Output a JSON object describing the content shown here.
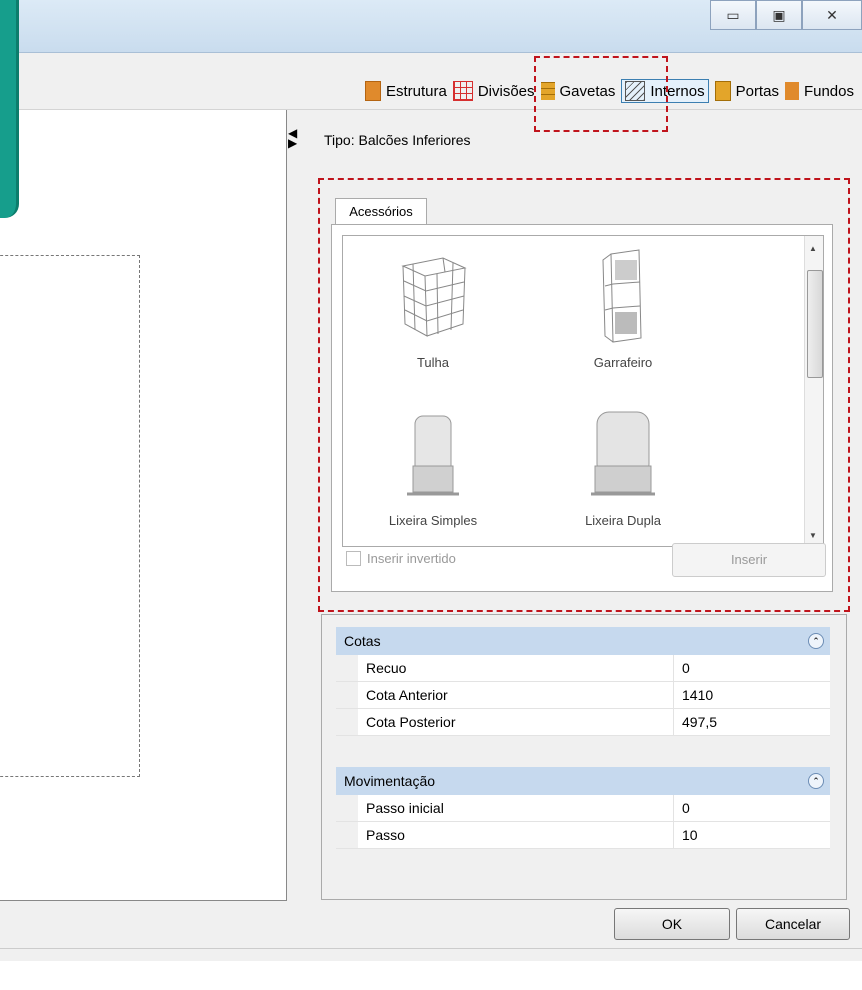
{
  "toolbar": {
    "items": [
      {
        "label": "Estrutura",
        "color": "#e08a2c"
      },
      {
        "label": "Divisões",
        "color": "#d62f2f"
      },
      {
        "label": "Gavetas",
        "color": "#e3a52a"
      },
      {
        "label": "Internos",
        "color": "#555555"
      },
      {
        "label": "Portas",
        "color": "#e3a52a"
      },
      {
        "label": "Fundos",
        "color": "#e08a2c"
      }
    ]
  },
  "tipo": "Tipo: Balcões Inferiores",
  "tabs": {
    "accessories": "Acessórios"
  },
  "gallery": {
    "items": [
      "Tulha",
      "Garrafeiro",
      "Lixeira Simples",
      "Lixeira Dupla"
    ]
  },
  "insert_inverted_label": "Inserir invertido",
  "insert_button": "Inserir",
  "props": {
    "cotas": {
      "title": "Cotas",
      "rows": [
        {
          "k": "Recuo",
          "v": "0"
        },
        {
          "k": "Cota Anterior",
          "v": "1410"
        },
        {
          "k": "Cota Posterior",
          "v": "497,5"
        }
      ]
    },
    "mov": {
      "title": "Movimentação",
      "rows": [
        {
          "k": "Passo inicial",
          "v": "0"
        },
        {
          "k": "Passo",
          "v": "10"
        }
      ]
    }
  },
  "buttons": {
    "ok": "OK",
    "cancel": "Cancelar"
  },
  "window_controls": {
    "minimize": "▭",
    "maximize": "▣",
    "close": "✕"
  }
}
